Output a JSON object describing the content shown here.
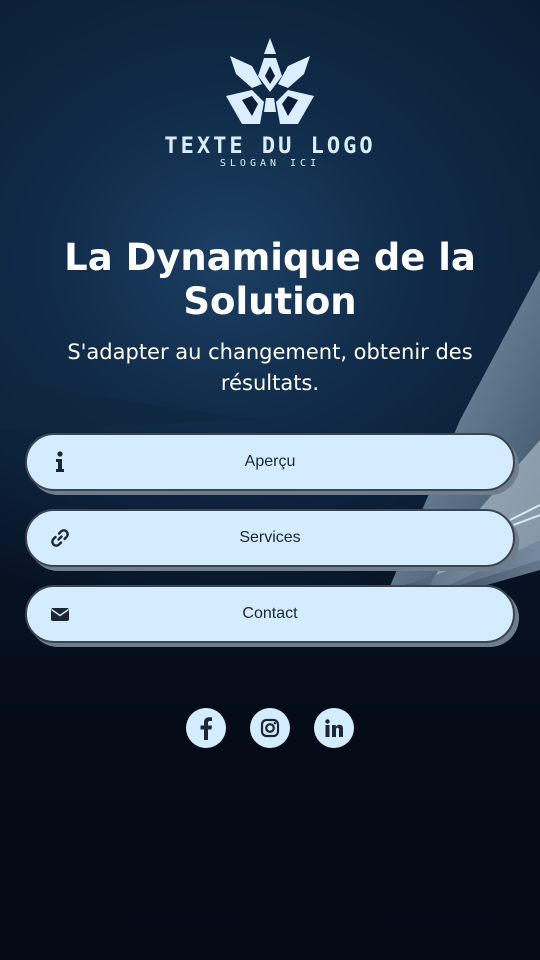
{
  "logo": {
    "text": "TEXTE DU LOGO",
    "slogan": "SLOGAN ICI",
    "icon": "crown-chevron-logo"
  },
  "hero": {
    "title": "La Dynamique de la Solution",
    "subtitle": "S'adapter au changement, obtenir des résultats."
  },
  "buttons": [
    {
      "label": "Aperçu",
      "icon": "info-icon"
    },
    {
      "label": "Services",
      "icon": "link-icon"
    },
    {
      "label": "Contact",
      "icon": "envelope-icon"
    }
  ],
  "social": [
    {
      "name": "facebook",
      "icon": "facebook-icon"
    },
    {
      "name": "instagram",
      "icon": "instagram-icon"
    },
    {
      "name": "linkedin",
      "icon": "linkedin-icon"
    }
  ],
  "colors": {
    "button_bg": "#d4ecff",
    "button_border": "#3b4552",
    "button_shadow": "#6f7d8c",
    "icon_dark": "#1d2733",
    "background": "#050b16",
    "logo_light": "#dbeeff"
  }
}
